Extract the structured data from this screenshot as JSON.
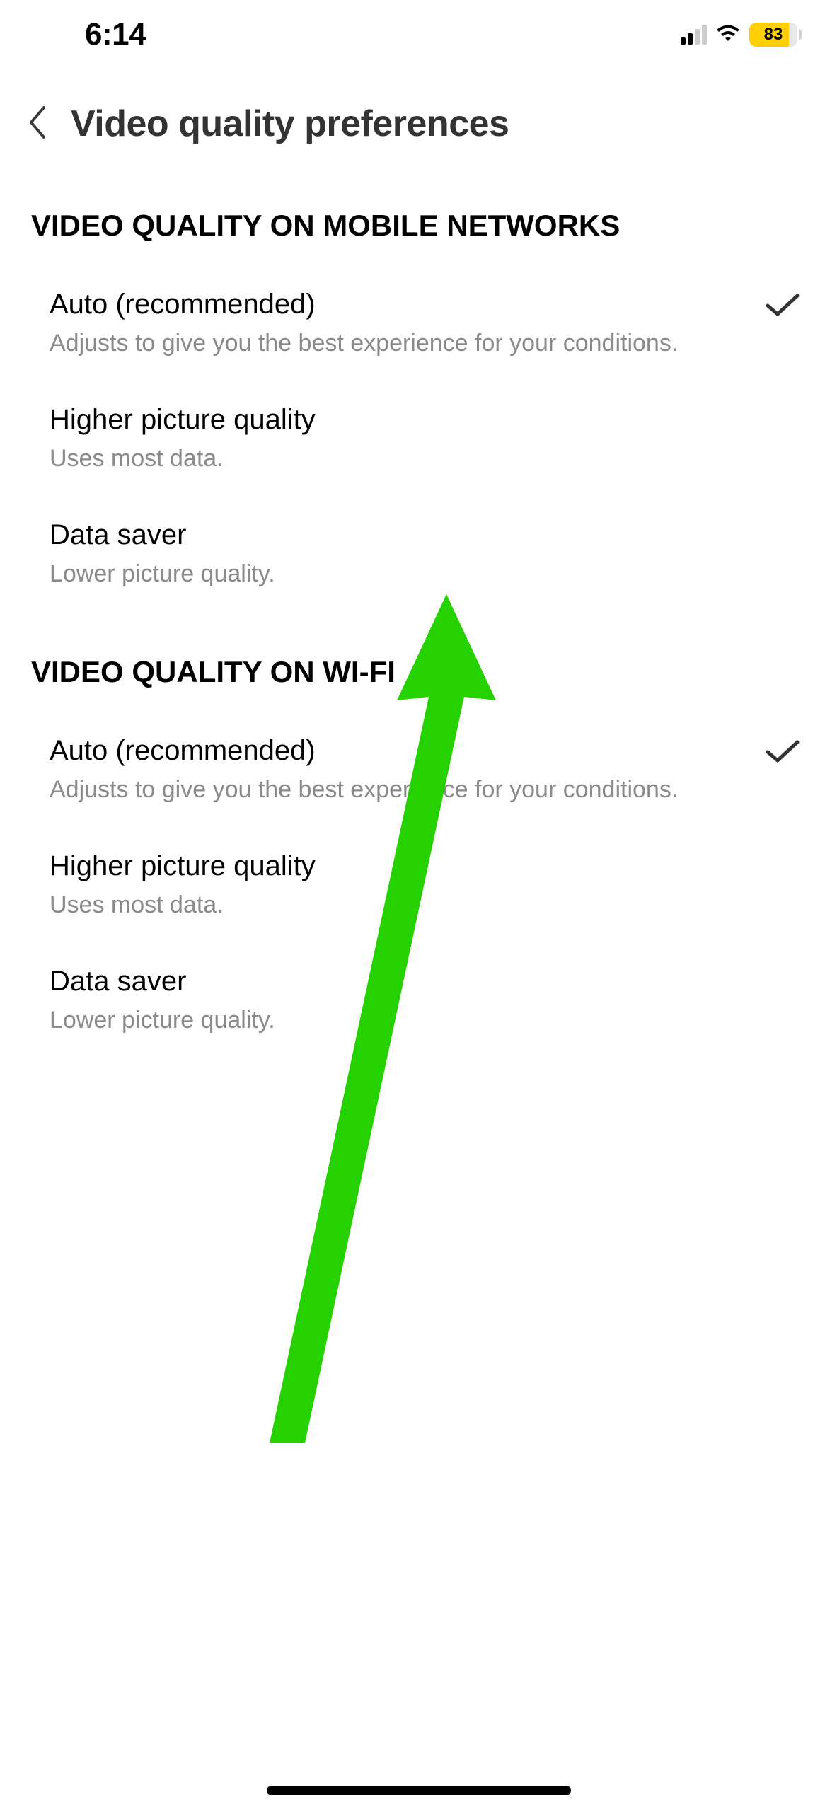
{
  "status_bar": {
    "time": "6:14",
    "battery_percent": "83"
  },
  "header": {
    "title": "Video quality preferences"
  },
  "sections": {
    "mobile": {
      "header": "VIDEO QUALITY ON MOBILE NETWORKS",
      "options": [
        {
          "title": "Auto (recommended)",
          "subtitle": "Adjusts to give you the best experience for your conditions.",
          "selected": true
        },
        {
          "title": "Higher picture quality",
          "subtitle": "Uses most data.",
          "selected": false
        },
        {
          "title": "Data saver",
          "subtitle": "Lower picture quality.",
          "selected": false
        }
      ]
    },
    "wifi": {
      "header": "VIDEO QUALITY ON WI-FI",
      "options": [
        {
          "title": "Auto (recommended)",
          "subtitle": "Adjusts to give you the best experience for your conditions.",
          "selected": true
        },
        {
          "title": "Higher picture quality",
          "subtitle": "Uses most data.",
          "selected": false
        },
        {
          "title": "Data saver",
          "subtitle": "Lower picture quality.",
          "selected": false
        }
      ]
    }
  }
}
